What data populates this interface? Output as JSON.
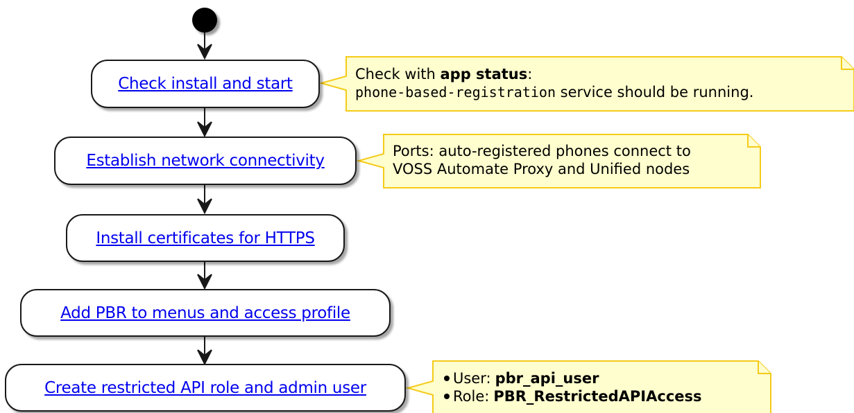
{
  "diagram": {
    "colors": {
      "start_dot": "#000000",
      "node_border": "#181818",
      "arrow": "#181818",
      "link_text": "#0000ee",
      "note_fill": "#fefece",
      "note_border": "#f5cb19"
    },
    "start_node": {
      "kind": "initial-state"
    },
    "steps": [
      {
        "label": "Check install and start"
      },
      {
        "label": "Establish network connectivity"
      },
      {
        "label": "Install certificates for HTTPS"
      },
      {
        "label": "Add PBR to menus and access profile"
      },
      {
        "label": "Create restricted API role and admin user"
      }
    ],
    "notes": {
      "install": {
        "line1_prefix": "Check with ",
        "line1_bold": "app status",
        "line1_suffix": ":",
        "line2_code": "phone-based-registration",
        "line2_rest": " service should be running."
      },
      "network": {
        "line1": "Ports: auto-registered phones connect to",
        "line2": "VOSS Automate Proxy and Unified nodes"
      },
      "role": {
        "user_label": "User: ",
        "user_value": "pbr_api_user",
        "role_label": "Role: ",
        "role_value": "PBR_RestrictedAPIAccess"
      }
    }
  }
}
